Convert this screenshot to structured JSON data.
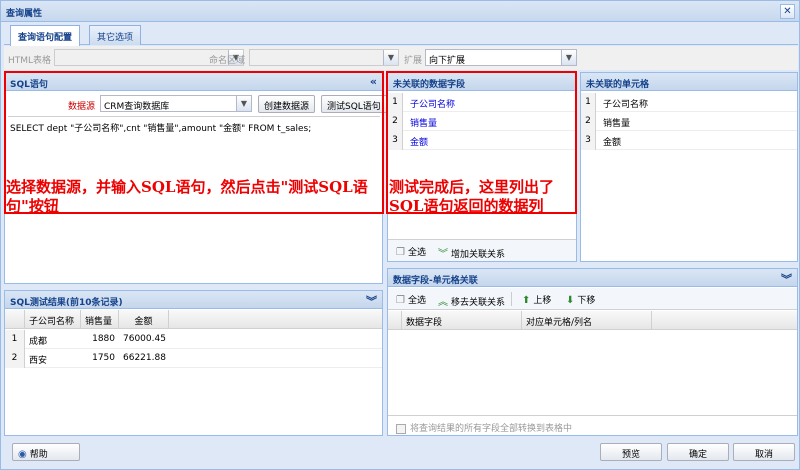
{
  "window": {
    "title": "查询属性",
    "close_glyph": "✕"
  },
  "tabs": [
    {
      "label": "查询语句配置"
    },
    {
      "label": "其它选项"
    }
  ],
  "toolbar": {
    "html_table_label": "HTML表格",
    "named_area_label": "命名区域",
    "expand_label": "扩展",
    "expand_value": "向下扩展"
  },
  "sql_panel": {
    "title": "SQL语句",
    "datasource_label": "数据源",
    "datasource_value": "CRM查询数据库",
    "create_ds_button": "创建数据源",
    "test_sql_button": "测试SQL语句",
    "sql_text": "SELECT dept \"子公司名称\",cnt \"销售量\",amount \"金额\" FROM t_sales;",
    "annotation": "选择数据源，并输入SQL语句，然后点击\"测试SQL语句\"按钮"
  },
  "unlinked_fields": {
    "title": "未关联的数据字段",
    "rows": [
      {
        "no": "1",
        "name": "子公司名称"
      },
      {
        "no": "2",
        "name": "销售量"
      },
      {
        "no": "3",
        "name": "金额"
      }
    ],
    "annotation": "测试完成后，这里列出了SQL语句返回的数据列",
    "select_all": "全选",
    "add_link": "增加关联关系"
  },
  "unlinked_cells": {
    "title": "未关联的单元格",
    "rows": [
      {
        "no": "1",
        "name": "子公司名称"
      },
      {
        "no": "2",
        "name": "销售量"
      },
      {
        "no": "3",
        "name": "金额"
      }
    ]
  },
  "test_result": {
    "title": "SQL测试结果(前10条记录)",
    "columns": [
      "子公司名称",
      "销售量",
      "金额"
    ],
    "rows": [
      {
        "no": "1",
        "name": "成都",
        "qty": "1880",
        "amount": "76000.45"
      },
      {
        "no": "2",
        "name": "西安",
        "qty": "1750",
        "amount": "66221.88"
      }
    ]
  },
  "link_panel": {
    "title": "数据字段-单元格关联",
    "select_all": "全选",
    "remove_link": "移去关联关系",
    "move_up": "上移",
    "move_down": "下移",
    "columns": [
      "数据字段",
      "对应单元格/列名"
    ],
    "checkbox_label": "将查询结果的所有字段全部转换到表格中"
  },
  "footer": {
    "help": "帮助",
    "preview": "预览",
    "ok": "确定",
    "cancel": "取消"
  },
  "colors": {
    "accent": "#15428b",
    "annotation": "#ee0000",
    "border": "#99bbe8"
  }
}
